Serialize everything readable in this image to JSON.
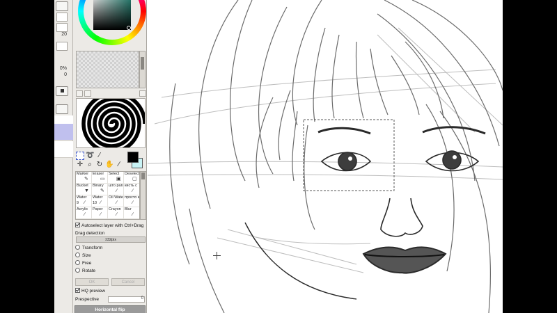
{
  "left_strip": {
    "values": [
      "",
      "20",
      "",
      "0%",
      "0"
    ]
  },
  "tool_panel": {
    "colors": {
      "foreground": "#000000",
      "background": "#c9f3f5",
      "picker_hue": "#2c8f7f"
    },
    "tool_icons": [
      "select-rect-icon",
      "lasso-icon",
      "magic-wand-icon",
      "move-icon",
      "zoom-icon",
      "rotate-icon",
      "hand-icon",
      "eyedropper-icon"
    ],
    "brushes": [
      {
        "label": "Marker",
        "size": ""
      },
      {
        "label": "Eraser",
        "size": ""
      },
      {
        "label": "Select",
        "size": ""
      },
      {
        "label": "Deselect",
        "size": ""
      },
      {
        "label": "Bucket",
        "size": ""
      },
      {
        "label": "Binary",
        "size": ""
      },
      {
        "label": "што\nрагазм",
        "size": ""
      },
      {
        "label": "кисть с",
        "size": ""
      },
      {
        "label": "Water",
        "size": "9"
      },
      {
        "label": "Water",
        "size": "10"
      },
      {
        "label": "Oil Water",
        "size": ""
      },
      {
        "label": "просто к",
        "size": ""
      },
      {
        "label": "Acrylic",
        "size": ""
      },
      {
        "label": "Paper",
        "size": ""
      },
      {
        "label": "Crayon",
        "size": ""
      },
      {
        "label": "Blur",
        "size": ""
      }
    ],
    "autoselect_label": "Autoselect layer with Ctrl+Drag",
    "drag_detection_label": "Drag detection",
    "drag_detection_value": "±32pix",
    "transform_options": [
      "Transform",
      "Size",
      "Free",
      "Rotate"
    ],
    "ok_label": "OK",
    "cancel_label": "Cancel",
    "hq_preview_label": "HQ preview",
    "perspective_label": "Prespective",
    "perspective_value": "0",
    "hflip_label": "Horizontal flip"
  }
}
